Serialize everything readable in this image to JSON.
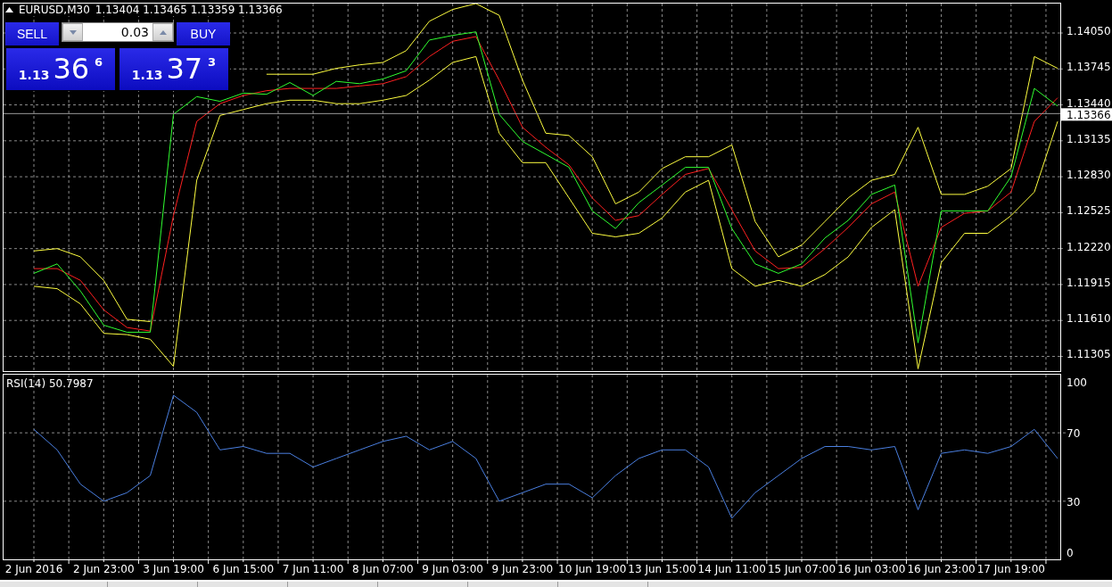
{
  "header": {
    "symbol": "EURUSD,M30",
    "quotes": "1.13404 1.13465 1.13359 1.13366"
  },
  "trade_panel": {
    "sell_label": "SELL",
    "buy_label": "BUY",
    "volume": "0.03",
    "sell_price": {
      "prefix": "1.13",
      "big": "36",
      "pip": "6"
    },
    "buy_price": {
      "prefix": "1.13",
      "big": "37",
      "pip": "3"
    }
  },
  "price_chart": {
    "chart_data": {
      "type": "line",
      "grid": true,
      "ylim": [
        1.1118,
        1.143
      ],
      "yticks": [
        {
          "value": 1.1405,
          "label": "1.14050"
        },
        {
          "value": 1.13745,
          "label": "1.13745"
        },
        {
          "value": 1.1344,
          "label": "1.13440"
        },
        {
          "value": 1.13135,
          "label": "1.13135"
        },
        {
          "value": 1.1283,
          "label": "1.12830"
        },
        {
          "value": 1.12525,
          "label": "1.12525"
        },
        {
          "value": 1.1222,
          "label": "1.12220"
        },
        {
          "value": 1.11915,
          "label": "1.11915"
        },
        {
          "value": 1.1161,
          "label": "1.11610"
        },
        {
          "value": 1.11305,
          "label": "1.11305"
        }
      ],
      "ref_lines": [
        {
          "axis": "y",
          "value": 1.13366,
          "label": "1.13366"
        }
      ],
      "series": [
        {
          "color": "#ffff40",
          "values": [
            1.122,
            1.1222,
            1.1215,
            1.1195,
            1.1162,
            1.116,
            null,
            null,
            null,
            null,
            1.137,
            1.137,
            1.137,
            1.1375,
            1.1378,
            1.138,
            1.139,
            1.1415,
            1.1425,
            1.143,
            1.142,
            1.1365,
            1.132,
            1.1318,
            1.13,
            1.126,
            1.127,
            1.129,
            1.13,
            1.13,
            1.131,
            1.1245,
            1.1215,
            1.1225,
            1.1245,
            1.1265,
            1.128,
            1.1285,
            1.1325,
            1.1268,
            1.1268,
            1.1275,
            1.129,
            1.1385,
            1.1375
          ]
        },
        {
          "color": "#ffff40",
          "values": [
            1.119,
            1.1188,
            1.1175,
            1.115,
            1.1149,
            1.1145,
            1.1122,
            1.128,
            1.1335,
            1.134,
            1.1345,
            1.1348,
            1.1348,
            1.1345,
            1.1345,
            1.1348,
            1.1352,
            1.1365,
            1.138,
            1.1385,
            1.132,
            1.1295,
            1.1295,
            1.1265,
            1.1235,
            1.1232,
            1.1235,
            1.1248,
            1.127,
            1.128,
            1.1205,
            1.119,
            1.1195,
            1.119,
            1.12,
            1.1215,
            1.124,
            1.1255,
            1.112,
            1.121,
            1.1235,
            1.1235,
            1.125,
            1.127,
            1.133
          ]
        },
        {
          "color": "#ff2020",
          "values": [
            1.1205,
            1.1205,
            1.1195,
            1.117,
            1.1155,
            1.1152,
            1.125,
            1.133,
            1.1345,
            1.1352,
            1.1356,
            1.1358,
            1.1358,
            1.1358,
            1.136,
            1.1362,
            1.1368,
            1.1385,
            1.1398,
            1.1402,
            1.1365,
            1.1325,
            1.1308,
            1.1293,
            1.1265,
            1.1246,
            1.125,
            1.1268,
            1.1285,
            1.129,
            1.1255,
            1.122,
            1.1205,
            1.1206,
            1.1222,
            1.124,
            1.126,
            1.127,
            1.119,
            1.124,
            1.1252,
            1.1254,
            1.127,
            1.133,
            1.135
          ]
        },
        {
          "color": "#30ff30",
          "values": [
            1.1201,
            1.1209,
            1.1186,
            1.1157,
            1.1151,
            1.1151,
            1.1336,
            1.1351,
            1.1347,
            1.1354,
            1.1353,
            1.1363,
            1.1352,
            1.1364,
            1.1362,
            1.1366,
            1.1373,
            1.1399,
            1.1403,
            1.1406,
            1.1336,
            1.1313,
            1.1302,
            1.1291,
            1.1254,
            1.1239,
            1.1261,
            1.1276,
            1.1291,
            1.1291,
            1.1239,
            1.1209,
            1.1201,
            1.1209,
            1.1231,
            1.1246,
            1.1268,
            1.1276,
            1.1142,
            1.1254,
            1.1254,
            1.1254,
            1.1283,
            1.1358,
            1.1343
          ]
        }
      ]
    }
  },
  "rsi_chart": {
    "title": "RSI(14) 50.7987",
    "chart_data": {
      "type": "line",
      "grid": true,
      "ylim": [
        -4,
        104
      ],
      "yticks": [
        0,
        30,
        70,
        100
      ],
      "categories": [
        "2 Jun 2016",
        null,
        null,
        "2 Jun 23:00",
        null,
        null,
        "3 Jun 19:00",
        null,
        null,
        "6 Jun 15:00",
        null,
        null,
        "7 Jun 11:00",
        null,
        null,
        "8 Jun 07:00",
        null,
        null,
        "9 Jun 03:00",
        null,
        null,
        "9 Jun 23:00",
        null,
        null,
        "10 Jun 19:00",
        null,
        null,
        "13 Jun 15:00",
        null,
        null,
        "14 Jun 11:00",
        null,
        null,
        "15 Jun 07:00",
        null,
        null,
        "16 Jun 03:00",
        null,
        null,
        "16 Jun 23:00",
        null,
        null,
        "17 Jun 19:00",
        null,
        null
      ],
      "series": [
        {
          "color": "#4a7fe0",
          "values": [
            72,
            60,
            40,
            30,
            35,
            45,
            92,
            82,
            60,
            62,
            58,
            58,
            50,
            55,
            60,
            65,
            68,
            60,
            65,
            55,
            30,
            35,
            40,
            40,
            32,
            45,
            55,
            60,
            60,
            50,
            20,
            35,
            45,
            55,
            62,
            62,
            60,
            62,
            25,
            58,
            60,
            58,
            62,
            72,
            55
          ]
        }
      ]
    }
  }
}
